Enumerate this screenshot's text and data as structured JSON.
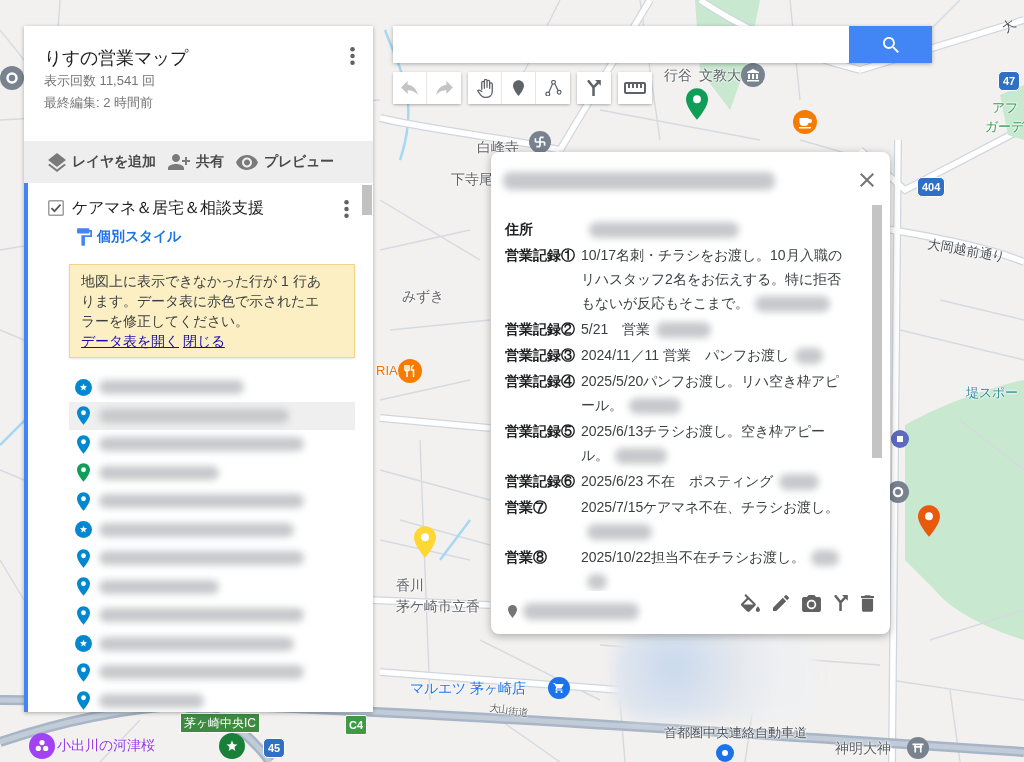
{
  "map_panel": {
    "title": "りすの営業マップ",
    "views": "表示回数 11,541 回",
    "last_edited": "最終編集: 2 時間前",
    "actions": [
      {
        "kind": "layers",
        "label": "レイヤを追加"
      },
      {
        "kind": "share",
        "label": "共有"
      },
      {
        "kind": "preview",
        "label": "プレビュー"
      }
    ],
    "layer": {
      "name": "ケアマネ＆居宅＆相談支援",
      "checked": true,
      "style_link": "個別スタイル",
      "warning": {
        "message": "地図上に表示できなかった行が 1 行あります。データ表に赤色で示されたエラーを修正してください。",
        "links": [
          "データ表を開く",
          "閉じる"
        ]
      },
      "features": [
        {
          "kind": "star",
          "color": "#0288d1",
          "selected": false
        },
        {
          "kind": "pin",
          "color": "#0288d1",
          "selected": true
        },
        {
          "kind": "pin",
          "color": "#0288d1",
          "selected": false
        },
        {
          "kind": "pin",
          "color": "#0f9d58",
          "selected": false
        },
        {
          "kind": "pin",
          "color": "#0288d1",
          "selected": false
        },
        {
          "kind": "star",
          "color": "#0288d1",
          "selected": false
        },
        {
          "kind": "pin",
          "color": "#0288d1",
          "selected": false
        },
        {
          "kind": "pin",
          "color": "#0288d1",
          "selected": false
        },
        {
          "kind": "pin",
          "color": "#0288d1",
          "selected": false
        },
        {
          "kind": "star",
          "color": "#0288d1",
          "selected": false
        },
        {
          "kind": "pin",
          "color": "#0288d1",
          "selected": false
        },
        {
          "kind": "pin",
          "color": "#0288d1",
          "selected": false
        }
      ]
    }
  },
  "toolbar": [
    {
      "tools": [
        {
          "kind": "undo",
          "disabled": true
        },
        {
          "kind": "redo",
          "disabled": true
        }
      ]
    },
    {
      "tools": [
        {
          "kind": "pan",
          "disabled": false
        },
        {
          "kind": "marker",
          "disabled": false
        },
        {
          "kind": "line",
          "disabled": false
        }
      ]
    },
    {
      "tools": [
        {
          "kind": "directions",
          "disabled": false
        }
      ]
    },
    {
      "tools": [
        {
          "kind": "measure",
          "disabled": false
        }
      ]
    }
  ],
  "popup": {
    "records": [
      {
        "label": "住所"
      },
      {
        "label": "営業記録①",
        "value": "10/17名刺・チラシをお渡し。10月入職のリハスタッフ2名をお伝えする。特に拒否もないが反応もそこまで。"
      },
      {
        "label": "営業記録②",
        "value": "5/21　営業"
      },
      {
        "label": "営業記録③",
        "value": "2024/11／11 営業　パンフお渡し"
      },
      {
        "label": "営業記録④",
        "value": "2025/5/20パンフお渡し。リハ空き枠アピール。"
      },
      {
        "label": "営業記録⑤",
        "value": "2025/6/13チラシお渡し。空き枠アピール。"
      },
      {
        "label": "営業記録⑥",
        "value": "2025/6/23 不在　ポスティング"
      },
      {
        "label": "営業⑦",
        "value": "2025/7/15ケアマネ不在、チラシお渡し。"
      },
      {
        "label": "営業⑧",
        "value": "2025/10/22担当不在チラシお渡し。"
      }
    ],
    "actions": [
      {
        "kind": "style"
      },
      {
        "kind": "edit"
      },
      {
        "kind": "photo"
      },
      {
        "kind": "directions"
      },
      {
        "kind": "delete"
      }
    ]
  },
  "map": {
    "labels": [
      {
        "text": "大",
        "kind": "road"
      },
      {
        "text": "行谷",
        "kind": "place"
      },
      {
        "text": "文教大",
        "kind": "place"
      },
      {
        "text": "47",
        "kind": "route"
      },
      {
        "text": "アフ",
        "kind": "park"
      },
      {
        "text": "ガーデ",
        "kind": "park"
      },
      {
        "text": "白峰寺",
        "kind": "place"
      },
      {
        "text": "下寺尾",
        "kind": "place"
      },
      {
        "text": "404",
        "kind": "route"
      },
      {
        "text": "大岡越前通り",
        "kind": "road"
      },
      {
        "text": "みずき",
        "kind": "place"
      },
      {
        "text": "RIA",
        "kind": "food"
      },
      {
        "text": "堤スポー",
        "kind": "sports"
      },
      {
        "text": "香川",
        "kind": "place"
      },
      {
        "text": "茅ケ崎市立香",
        "kind": "place"
      },
      {
        "text": "マルエツ 茅ヶ崎店",
        "kind": "shop"
      },
      {
        "text": "茅ヶ崎中央IC",
        "kind": "interchange"
      },
      {
        "text": "C4",
        "kind": "expressway"
      },
      {
        "text": "大山街道",
        "kind": "street"
      },
      {
        "text": "小出川の河津桜",
        "kind": "sight"
      },
      {
        "text": "45",
        "kind": "route"
      },
      {
        "text": "首都圏中央連絡自動車道",
        "kind": "road"
      },
      {
        "text": "神明大神",
        "kind": "place"
      }
    ],
    "markers": [
      {
        "color": "#0f9d58"
      },
      {
        "color": "#fdd835"
      },
      {
        "color": "#e8590c"
      }
    ]
  }
}
